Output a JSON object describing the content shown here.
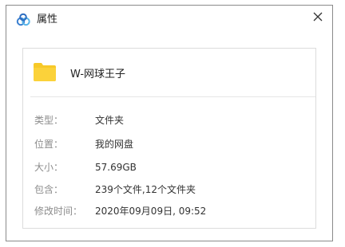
{
  "window": {
    "title": "属性"
  },
  "file": {
    "name": "W-网球王子"
  },
  "properties": [
    {
      "label": "类型：",
      "value": "文件夹"
    },
    {
      "label": "位置：",
      "value": "我的网盘"
    },
    {
      "label": "大小：",
      "value": "57.69GB"
    },
    {
      "label": "包含：",
      "value": "239个文件,12个文件夹"
    },
    {
      "label": "修改时间：",
      "value": "2020年09月09日, 09:52"
    }
  ],
  "icons": {
    "app": "cloud-drive-icon",
    "close": "close-icon",
    "folder": "folder-icon"
  },
  "colors": {
    "app_icon": "#3a7fd0",
    "folder": "#f7c928",
    "label_text": "#8c8c8c"
  }
}
